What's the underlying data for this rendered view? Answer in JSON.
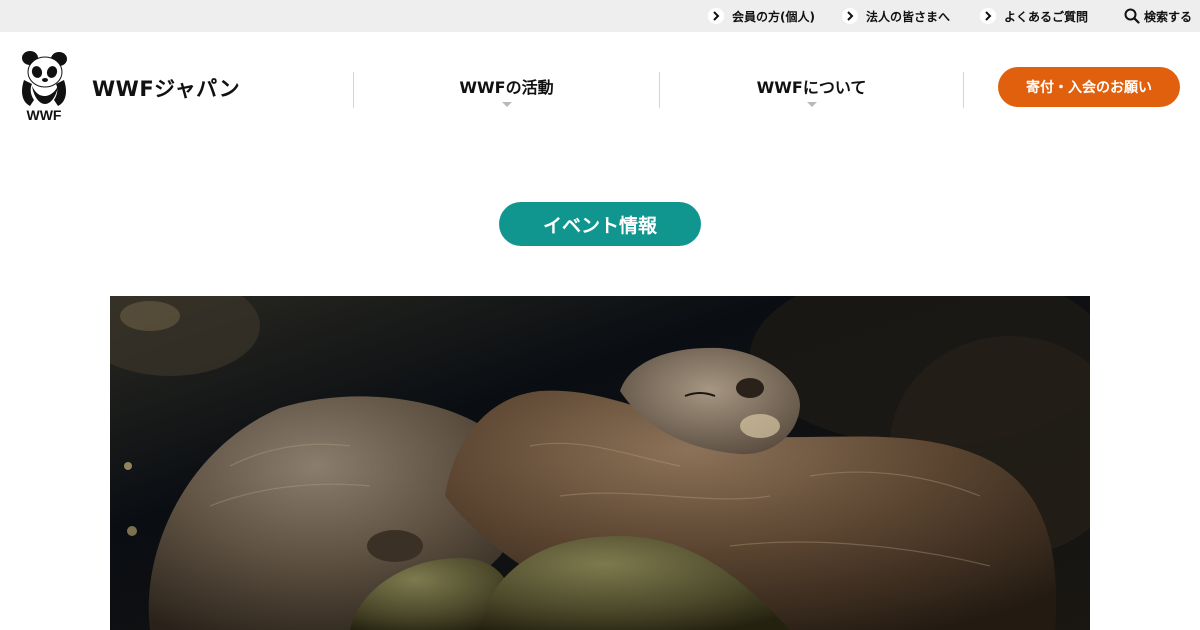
{
  "utility_bar": {
    "links": [
      {
        "label": "会員の方(個人)"
      },
      {
        "label": "法人の皆さまへ"
      },
      {
        "label": "よくあるご質問"
      }
    ],
    "search_label": "検索する"
  },
  "header": {
    "logo_text": "WWF",
    "site_name": "WWFジャパン",
    "nav": [
      {
        "label": "WWFの活動"
      },
      {
        "label": "WWFについて"
      }
    ],
    "donate_label": "寄付・入会のお願い"
  },
  "main": {
    "section_badge": "イベント情報",
    "hero_image": "otters-resting-on-rocks"
  },
  "colors": {
    "accent_orange": "#e0600e",
    "accent_teal": "#11968f",
    "utility_bg": "#eeeeee"
  }
}
